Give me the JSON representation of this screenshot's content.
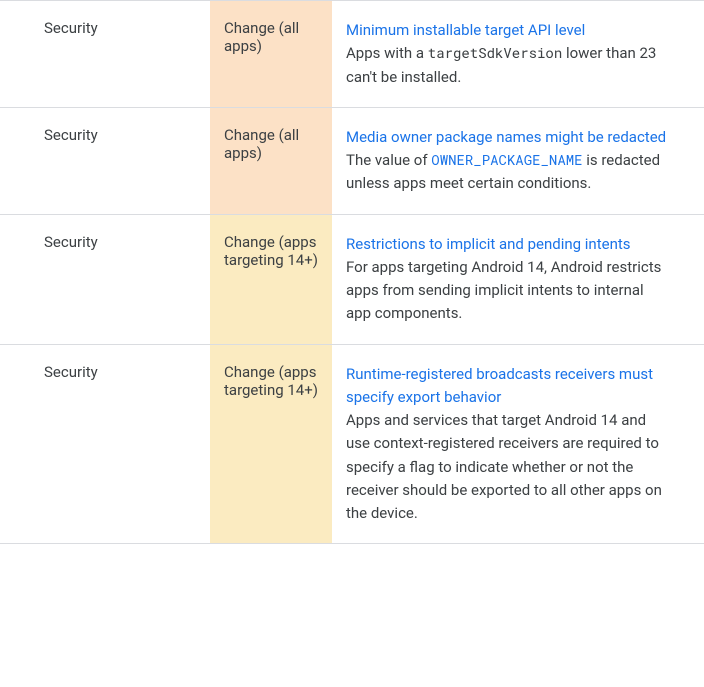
{
  "rows": [
    {
      "category": "Security",
      "type": "Change (all apps)",
      "highlight": "orange",
      "link": "Minimum installable target API level",
      "desc_pre": "Apps with a ",
      "code": "targetSdkVersion",
      "code_is_link": false,
      "desc_post": " lower than 23 can't be installed."
    },
    {
      "category": "Security",
      "type": "Change (all apps)",
      "highlight": "orange",
      "link": "Media owner package names might be redacted",
      "desc_pre": "The value of ",
      "code": "OWNER_PACKAGE_NAME",
      "code_is_link": true,
      "desc_post": " is redacted unless apps meet certain conditions."
    },
    {
      "category": "Security",
      "type": "Change (apps targeting 14+)",
      "highlight": "yellow",
      "link": "Restrictions to implicit and pending intents",
      "desc_pre": "For apps targeting Android 14, Android restricts apps from sending implicit intents to internal app components.",
      "code": null,
      "code_is_link": false,
      "desc_post": ""
    },
    {
      "category": "Security",
      "type": "Change (apps targeting 14+)",
      "highlight": "yellow",
      "link": "Runtime-registered broadcasts receivers must specify export behavior",
      "desc_pre": "Apps and services that target Android 14 and use context-registered receivers are required to specify a flag to indicate whether or not the receiver should be exported to all other apps on the device.",
      "code": null,
      "code_is_link": false,
      "desc_post": ""
    }
  ]
}
